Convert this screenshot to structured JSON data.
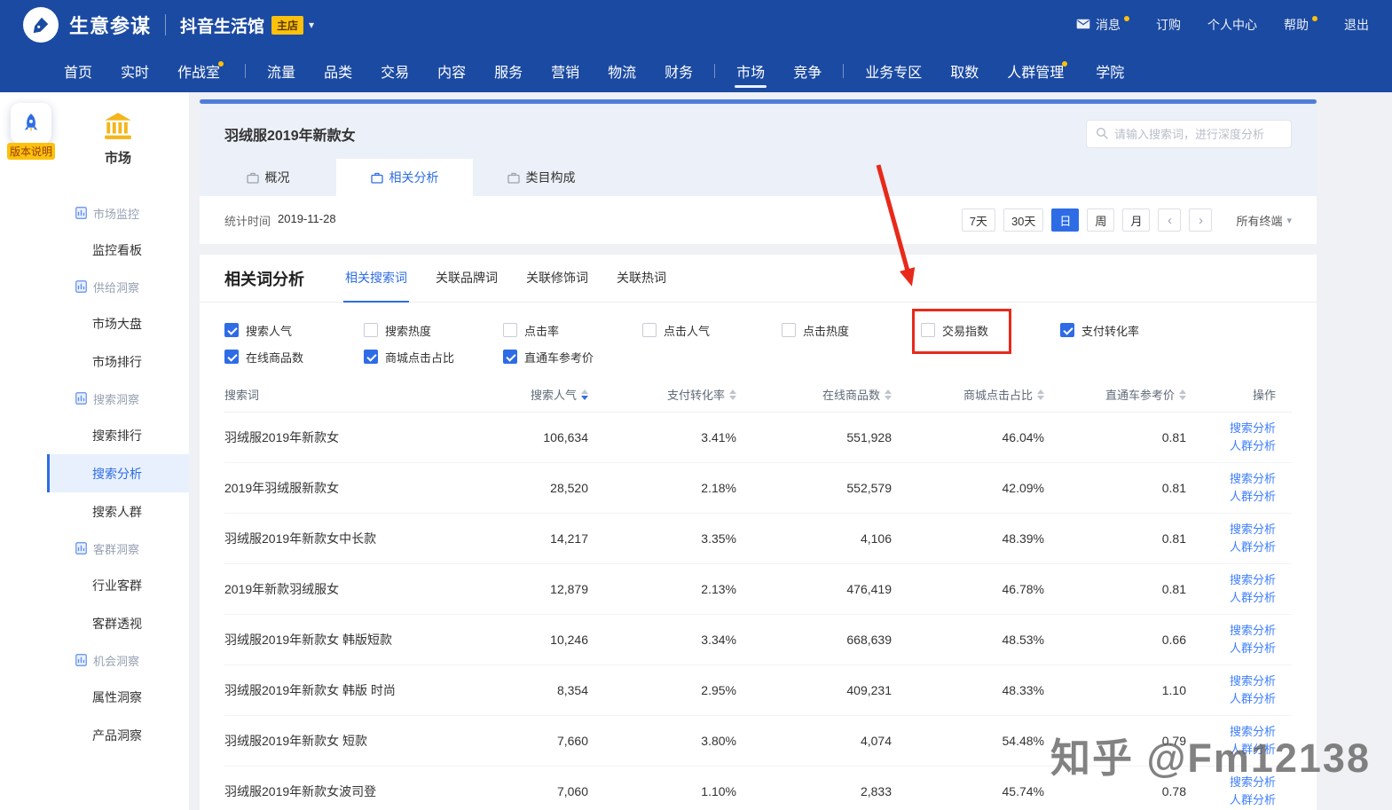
{
  "header": {
    "brand": "生意参谋",
    "shop_name": "抖音生活馆",
    "shop_badge": "主店",
    "links": [
      {
        "label": "消息",
        "icon": "mail",
        "dot": true
      },
      {
        "label": "订购",
        "dot": false
      },
      {
        "label": "个人中心",
        "dot": false
      },
      {
        "label": "帮助",
        "dot": true
      },
      {
        "label": "退出",
        "dot": false
      }
    ]
  },
  "nav": {
    "items": [
      {
        "label": "首页"
      },
      {
        "label": "实时"
      },
      {
        "label": "作战室",
        "dot": true
      },
      {
        "divider": true
      },
      {
        "label": "流量"
      },
      {
        "label": "品类"
      },
      {
        "label": "交易"
      },
      {
        "label": "内容"
      },
      {
        "label": "服务"
      },
      {
        "label": "营销"
      },
      {
        "label": "物流"
      },
      {
        "label": "财务"
      },
      {
        "divider": true
      },
      {
        "label": "市场",
        "active": true
      },
      {
        "label": "竞争"
      },
      {
        "divider": true
      },
      {
        "label": "业务专区"
      },
      {
        "label": "取数"
      },
      {
        "label": "人群管理",
        "dot": true
      },
      {
        "label": "学院"
      }
    ]
  },
  "sidebar": {
    "version_note": "版本说明",
    "module_title": "市场",
    "menu": [
      {
        "type": "group",
        "label": "市场监控"
      },
      {
        "type": "item",
        "label": "监控看板"
      },
      {
        "type": "group",
        "label": "供给洞察"
      },
      {
        "type": "item",
        "label": "市场大盘"
      },
      {
        "type": "item",
        "label": "市场排行"
      },
      {
        "type": "group",
        "label": "搜索洞察"
      },
      {
        "type": "item",
        "label": "搜索排行"
      },
      {
        "type": "item",
        "label": "搜索分析",
        "active": true
      },
      {
        "type": "item",
        "label": "搜索人群"
      },
      {
        "type": "group",
        "label": "客群洞察"
      },
      {
        "type": "item",
        "label": "行业客群"
      },
      {
        "type": "item",
        "label": "客群透视"
      },
      {
        "type": "group",
        "label": "机会洞察"
      },
      {
        "type": "item",
        "label": "属性洞察"
      },
      {
        "type": "item",
        "label": "产品洞察"
      }
    ]
  },
  "keyword_panel": {
    "keyword": "羽绒服2019年新款女",
    "search_placeholder": "请输入搜索词，进行深度分析",
    "tabs": [
      {
        "label": "概况"
      },
      {
        "label": "相关分析",
        "active": true
      },
      {
        "label": "类目构成"
      }
    ],
    "stats_time_label": "统计时间",
    "stats_date": "2019-11-28",
    "date_ranges": [
      {
        "label": "7天"
      },
      {
        "label": "30天"
      },
      {
        "label": "日",
        "active": true
      },
      {
        "label": "周"
      },
      {
        "label": "月"
      }
    ],
    "pager_prev": "‹",
    "pager_next": "›",
    "terminal_filter": "所有终端"
  },
  "analysis": {
    "title": "相关词分析",
    "tabs": [
      {
        "label": "相关搜索词",
        "active": true
      },
      {
        "label": "关联品牌词"
      },
      {
        "label": "关联修饰词"
      },
      {
        "label": "关联热词"
      }
    ],
    "metrics": [
      {
        "label": "搜索人气",
        "checked": true
      },
      {
        "label": "搜索热度",
        "checked": false
      },
      {
        "label": "点击率",
        "checked": false
      },
      {
        "label": "点击人气",
        "checked": false
      },
      {
        "label": "点击热度",
        "checked": false
      },
      {
        "label": "交易指数",
        "checked": false,
        "highlighted": true
      },
      {
        "label": "支付转化率",
        "checked": true
      },
      {
        "label": "在线商品数",
        "checked": true
      },
      {
        "label": "商城点击占比",
        "checked": true
      },
      {
        "label": "直通车参考价",
        "checked": true
      }
    ]
  },
  "table": {
    "columns": [
      "搜索词",
      "搜索人气",
      "支付转化率",
      "在线商品数",
      "商城点击占比",
      "直通车参考价",
      "操作"
    ],
    "action_links": [
      "搜索分析",
      "人群分析"
    ],
    "rows": [
      {
        "keyword": "羽绒服2019年新款女",
        "search_popularity": "106,634",
        "conversion": "3.41%",
        "products": "551,928",
        "mall_ratio": "46.04%",
        "ref_price": "0.81"
      },
      {
        "keyword": "2019年羽绒服新款女",
        "search_popularity": "28,520",
        "conversion": "2.18%",
        "products": "552,579",
        "mall_ratio": "42.09%",
        "ref_price": "0.81"
      },
      {
        "keyword": "羽绒服2019年新款女中长款",
        "search_popularity": "14,217",
        "conversion": "3.35%",
        "products": "4,106",
        "mall_ratio": "48.39%",
        "ref_price": "0.81"
      },
      {
        "keyword": "2019年新款羽绒服女",
        "search_popularity": "12,879",
        "conversion": "2.13%",
        "products": "476,419",
        "mall_ratio": "46.78%",
        "ref_price": "0.81"
      },
      {
        "keyword": "羽绒服2019年新款女 韩版短款",
        "search_popularity": "10,246",
        "conversion": "3.34%",
        "products": "668,639",
        "mall_ratio": "48.53%",
        "ref_price": "0.66"
      },
      {
        "keyword": "羽绒服2019年新款女 韩版 时尚",
        "search_popularity": "8,354",
        "conversion": "2.95%",
        "products": "409,231",
        "mall_ratio": "48.33%",
        "ref_price": "1.10"
      },
      {
        "keyword": "羽绒服2019年新款女 短款",
        "search_popularity": "7,660",
        "conversion": "3.80%",
        "products": "4,074",
        "mall_ratio": "54.48%",
        "ref_price": "0.79"
      },
      {
        "keyword": "羽绒服2019年新款女波司登",
        "search_popularity": "7,060",
        "conversion": "1.10%",
        "products": "2,833",
        "mall_ratio": "45.74%",
        "ref_price": "0.78"
      }
    ]
  },
  "watermark": "知乎 @Fm12138",
  "colors": {
    "header_blue": "#1b4aa2",
    "accent_blue": "#2e6ce5",
    "badge_yellow": "#fbc10c",
    "annotation_red": "#e8291a"
  }
}
